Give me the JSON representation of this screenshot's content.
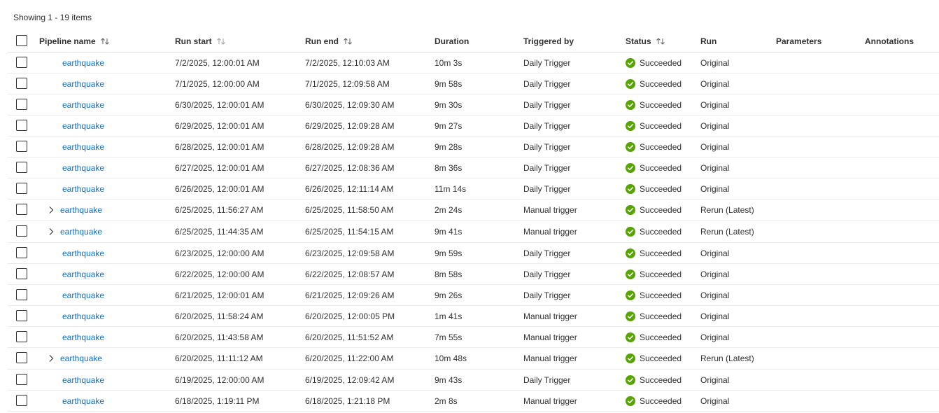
{
  "summary": "Showing 1 - 19 items",
  "columns": {
    "pipeline_name": "Pipeline name",
    "run_start": "Run start",
    "run_end": "Run end",
    "duration": "Duration",
    "triggered_by": "Triggered by",
    "status": "Status",
    "run": "Run",
    "parameters": "Parameters",
    "annotations": "Annotations"
  },
  "colors": {
    "link": "#106ebe",
    "success": "#57a300"
  },
  "rows": [
    {
      "name": "earthquake",
      "expandable": false,
      "start": "7/2/2025, 12:00:01 AM",
      "end": "7/2/2025, 12:10:03 AM",
      "duration": "10m 3s",
      "trigger": "Daily Trigger",
      "status": "Succeeded",
      "run": "Original"
    },
    {
      "name": "earthquake",
      "expandable": false,
      "start": "7/1/2025, 12:00:00 AM",
      "end": "7/1/2025, 12:09:58 AM",
      "duration": "9m 58s",
      "trigger": "Daily Trigger",
      "status": "Succeeded",
      "run": "Original"
    },
    {
      "name": "earthquake",
      "expandable": false,
      "start": "6/30/2025, 12:00:01 AM",
      "end": "6/30/2025, 12:09:30 AM",
      "duration": "9m 30s",
      "trigger": "Daily Trigger",
      "status": "Succeeded",
      "run": "Original"
    },
    {
      "name": "earthquake",
      "expandable": false,
      "start": "6/29/2025, 12:00:01 AM",
      "end": "6/29/2025, 12:09:28 AM",
      "duration": "9m 27s",
      "trigger": "Daily Trigger",
      "status": "Succeeded",
      "run": "Original"
    },
    {
      "name": "earthquake",
      "expandable": false,
      "start": "6/28/2025, 12:00:01 AM",
      "end": "6/28/2025, 12:09:28 AM",
      "duration": "9m 28s",
      "trigger": "Daily Trigger",
      "status": "Succeeded",
      "run": "Original"
    },
    {
      "name": "earthquake",
      "expandable": false,
      "start": "6/27/2025, 12:00:01 AM",
      "end": "6/27/2025, 12:08:36 AM",
      "duration": "8m 36s",
      "trigger": "Daily Trigger",
      "status": "Succeeded",
      "run": "Original"
    },
    {
      "name": "earthquake",
      "expandable": false,
      "start": "6/26/2025, 12:00:01 AM",
      "end": "6/26/2025, 12:11:14 AM",
      "duration": "11m 14s",
      "trigger": "Daily Trigger",
      "status": "Succeeded",
      "run": "Original"
    },
    {
      "name": "earthquake",
      "expandable": true,
      "start": "6/25/2025, 11:56:27 AM",
      "end": "6/25/2025, 11:58:50 AM",
      "duration": "2m 24s",
      "trigger": "Manual trigger",
      "status": "Succeeded",
      "run": "Rerun (Latest)"
    },
    {
      "name": "earthquake",
      "expandable": true,
      "start": "6/25/2025, 11:44:35 AM",
      "end": "6/25/2025, 11:54:15 AM",
      "duration": "9m 41s",
      "trigger": "Manual trigger",
      "status": "Succeeded",
      "run": "Rerun (Latest)"
    },
    {
      "name": "earthquake",
      "expandable": false,
      "start": "6/23/2025, 12:00:00 AM",
      "end": "6/23/2025, 12:09:58 AM",
      "duration": "9m 59s",
      "trigger": "Daily Trigger",
      "status": "Succeeded",
      "run": "Original"
    },
    {
      "name": "earthquake",
      "expandable": false,
      "start": "6/22/2025, 12:00:00 AM",
      "end": "6/22/2025, 12:08:57 AM",
      "duration": "8m 58s",
      "trigger": "Daily Trigger",
      "status": "Succeeded",
      "run": "Original"
    },
    {
      "name": "earthquake",
      "expandable": false,
      "start": "6/21/2025, 12:00:01 AM",
      "end": "6/21/2025, 12:09:26 AM",
      "duration": "9m 26s",
      "trigger": "Daily Trigger",
      "status": "Succeeded",
      "run": "Original"
    },
    {
      "name": "earthquake",
      "expandable": false,
      "start": "6/20/2025, 11:58:24 AM",
      "end": "6/20/2025, 12:00:05 PM",
      "duration": "1m 41s",
      "trigger": "Manual trigger",
      "status": "Succeeded",
      "run": "Original"
    },
    {
      "name": "earthquake",
      "expandable": false,
      "start": "6/20/2025, 11:43:58 AM",
      "end": "6/20/2025, 11:51:52 AM",
      "duration": "7m 55s",
      "trigger": "Manual trigger",
      "status": "Succeeded",
      "run": "Original"
    },
    {
      "name": "earthquake",
      "expandable": true,
      "start": "6/20/2025, 11:11:12 AM",
      "end": "6/20/2025, 11:22:00 AM",
      "duration": "10m 48s",
      "trigger": "Manual trigger",
      "status": "Succeeded",
      "run": "Rerun (Latest)"
    },
    {
      "name": "earthquake",
      "expandable": false,
      "start": "6/19/2025, 12:00:00 AM",
      "end": "6/19/2025, 12:09:42 AM",
      "duration": "9m 43s",
      "trigger": "Daily Trigger",
      "status": "Succeeded",
      "run": "Original"
    },
    {
      "name": "earthquake",
      "expandable": false,
      "start": "6/18/2025, 1:19:11 PM",
      "end": "6/18/2025, 1:21:18 PM",
      "duration": "2m 8s",
      "trigger": "Manual trigger",
      "status": "Succeeded",
      "run": "Original"
    }
  ]
}
